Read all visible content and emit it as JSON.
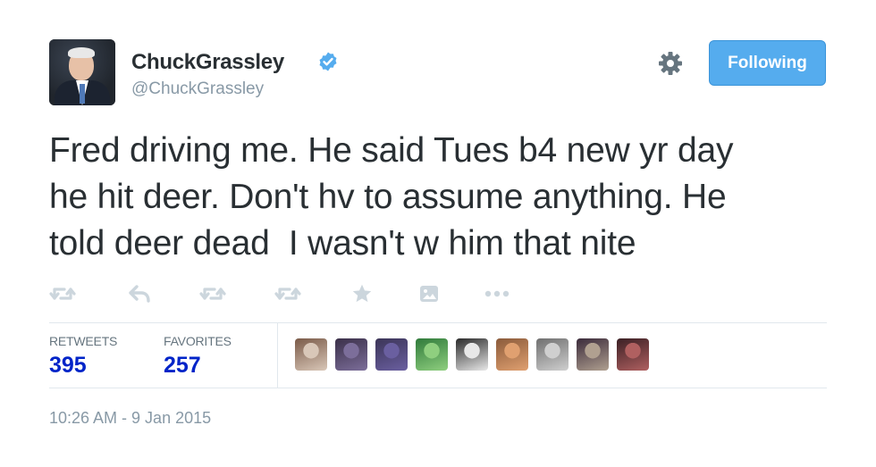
{
  "user": {
    "name": "ChuckGrassley",
    "handle": "@ChuckGrassley",
    "verified": true
  },
  "follow_button": {
    "label": "Following"
  },
  "tweet": {
    "text": "Fred driving me. He said Tues b4 new yr day\nhe hit deer. Don't hv to assume anything. He\ntold deer dead  I wasn't w him that nite"
  },
  "actions": [
    {
      "icon": "retweet-icon"
    },
    {
      "icon": "reply-icon"
    },
    {
      "icon": "retweet-icon"
    },
    {
      "icon": "retweet-icon"
    },
    {
      "icon": "star-icon"
    },
    {
      "icon": "image-icon"
    },
    {
      "icon": "more-icon"
    }
  ],
  "stats": {
    "retweets_label": "RETWEETS",
    "retweets": "395",
    "favorites_label": "FAVORITES",
    "favorites": "257"
  },
  "favoriters": [
    {
      "colors": [
        "#7a5a48",
        "#d9c7b8"
      ]
    },
    {
      "colors": [
        "#3a2f48",
        "#7c6e9a"
      ]
    },
    {
      "colors": [
        "#3b3457",
        "#6a5fa0"
      ]
    },
    {
      "colors": [
        "#2f7a3a",
        "#8fcf7f"
      ]
    },
    {
      "colors": [
        "#2a2a2a",
        "#e8e8e8"
      ]
    },
    {
      "colors": [
        "#8a5a3a",
        "#e0a070"
      ]
    },
    {
      "colors": [
        "#6f6f6f",
        "#cfcfcf"
      ]
    },
    {
      "colors": [
        "#3a2a3a",
        "#b0a090"
      ]
    },
    {
      "colors": [
        "#3a1f24",
        "#b06060"
      ]
    }
  ],
  "timestamp": "10:26 AM - 9 Jan 2015",
  "colors": {
    "accent": "#55acee",
    "count": "#0024c8",
    "muted": "#8899a6",
    "icon": "#ccd6dd"
  }
}
